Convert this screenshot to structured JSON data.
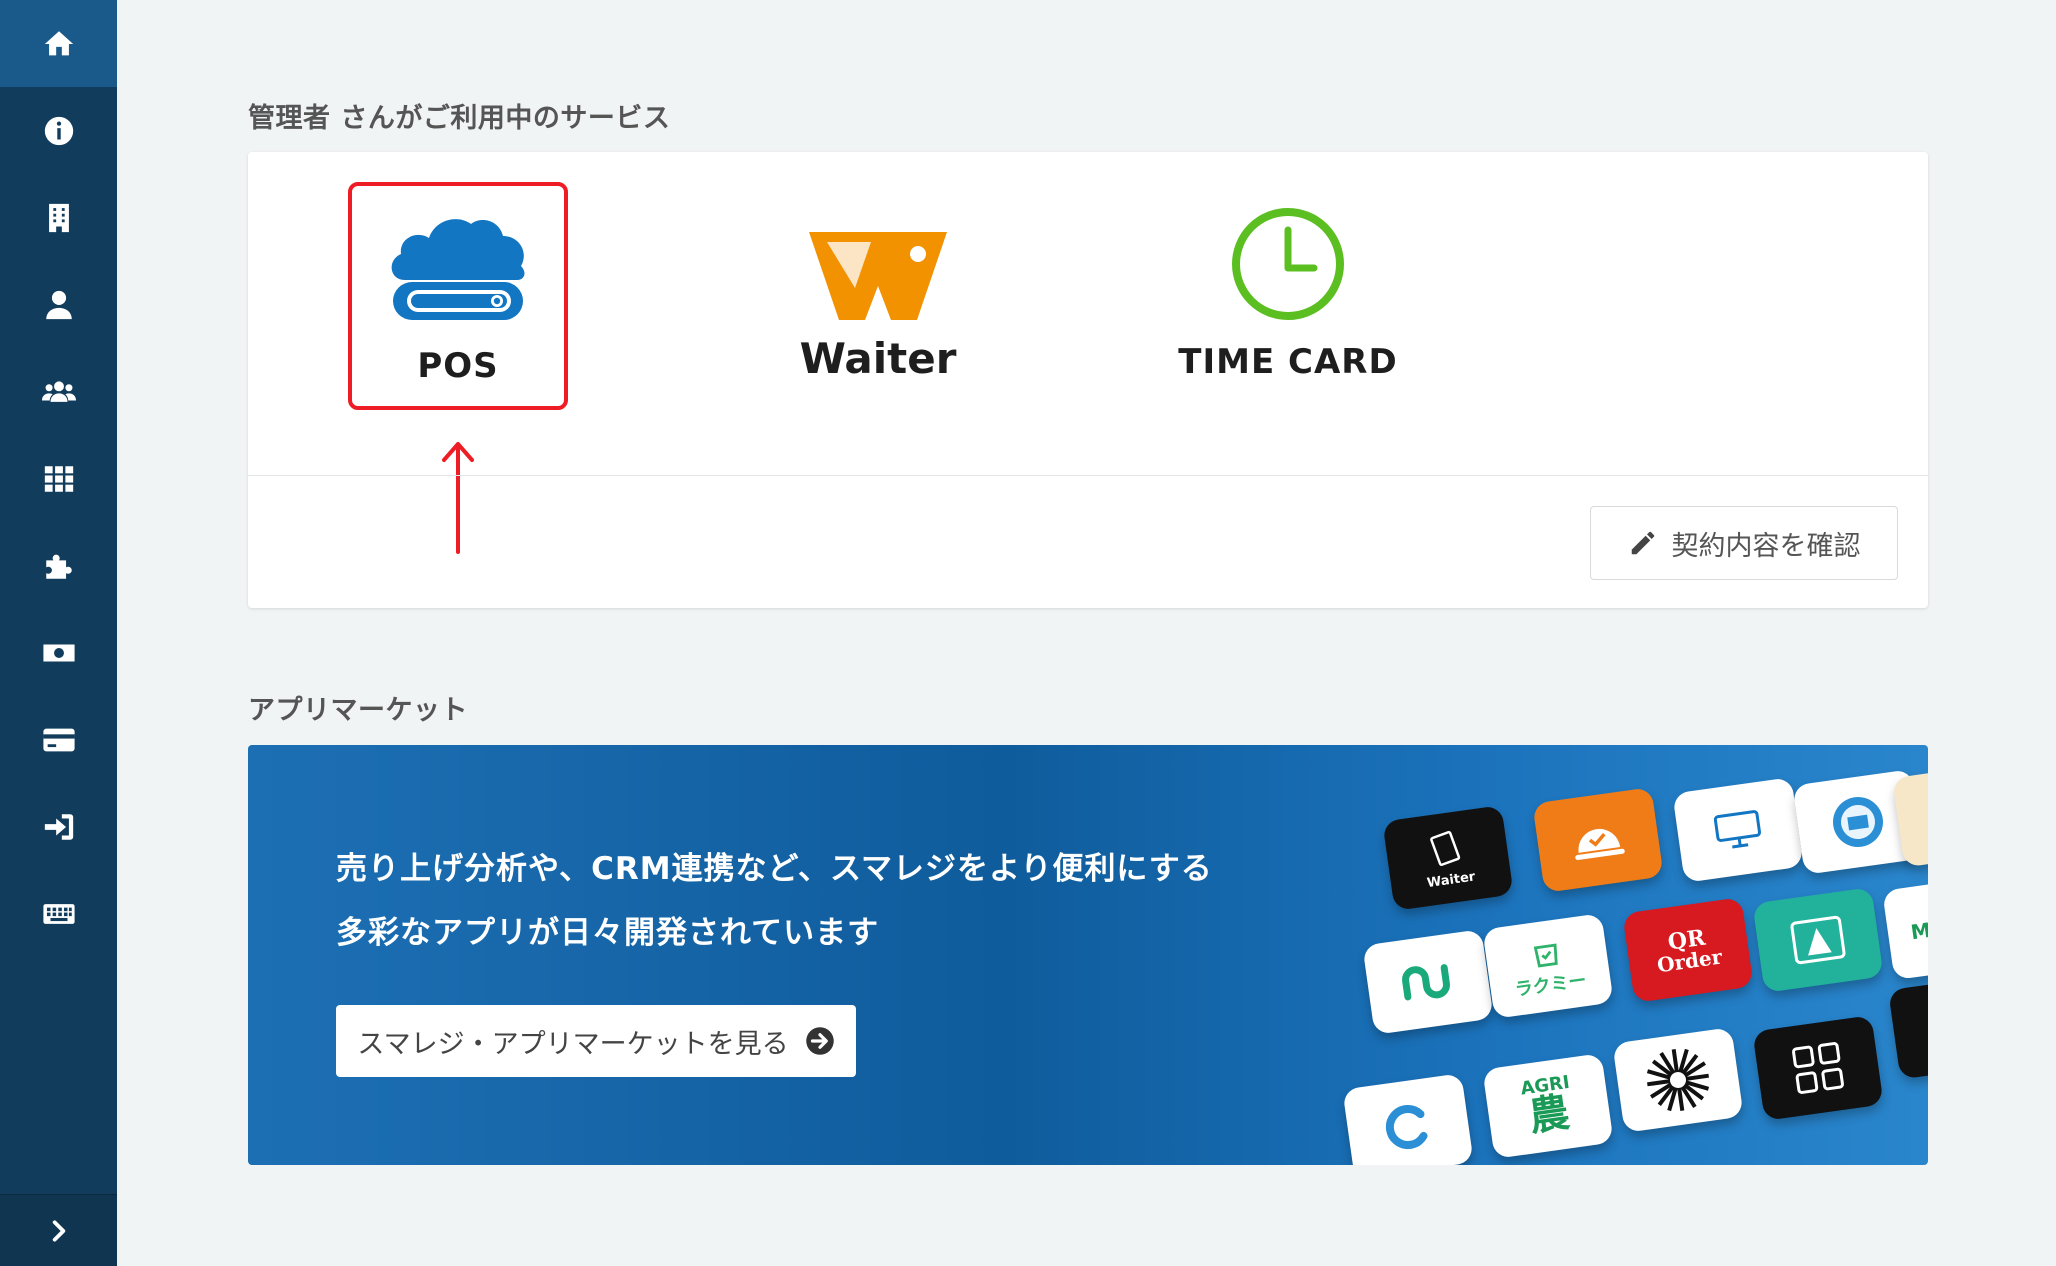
{
  "sidebar": {
    "items": [
      {
        "icon": "home-icon",
        "active": true
      },
      {
        "icon": "info-icon"
      },
      {
        "icon": "building-icon"
      },
      {
        "icon": "user-icon"
      },
      {
        "icon": "users-icon"
      },
      {
        "icon": "grid-icon"
      },
      {
        "icon": "puzzle-icon"
      },
      {
        "icon": "money-icon"
      },
      {
        "icon": "credit-card-icon"
      },
      {
        "icon": "sign-in-icon"
      },
      {
        "icon": "keyboard-icon"
      }
    ],
    "expand_icon": "chevron-right-icon"
  },
  "services": {
    "heading": "管理者 さんがご利用中のサービス",
    "items": [
      {
        "label": "POS",
        "icon": "cloud-pos-icon",
        "color": "#1276c3",
        "highlighted": true
      },
      {
        "label": "Waiter",
        "icon": "waiter-logo-icon",
        "color": "#f39200"
      },
      {
        "label": "TIME CARD",
        "icon": "clock-icon",
        "color": "#5bbf21"
      }
    ],
    "contract_button": "契約内容を確認",
    "highlight_color": "#ee1c25"
  },
  "market": {
    "heading": "アプリマーケット",
    "banner_line1": "売り上げ分析や、CRM連携など、スマレジをより便利にする",
    "banner_line2": "多彩なアプリが日々開発されています",
    "button_label": "スマレジ・アプリマーケットを見る",
    "tiles": {
      "waiter": "Waiter",
      "qr_line1": "QR",
      "qr_line2": "Order",
      "rakumi": "ラクミー",
      "agri": "AGRI",
      "nou": "農",
      "mr": "Mr."
    }
  }
}
